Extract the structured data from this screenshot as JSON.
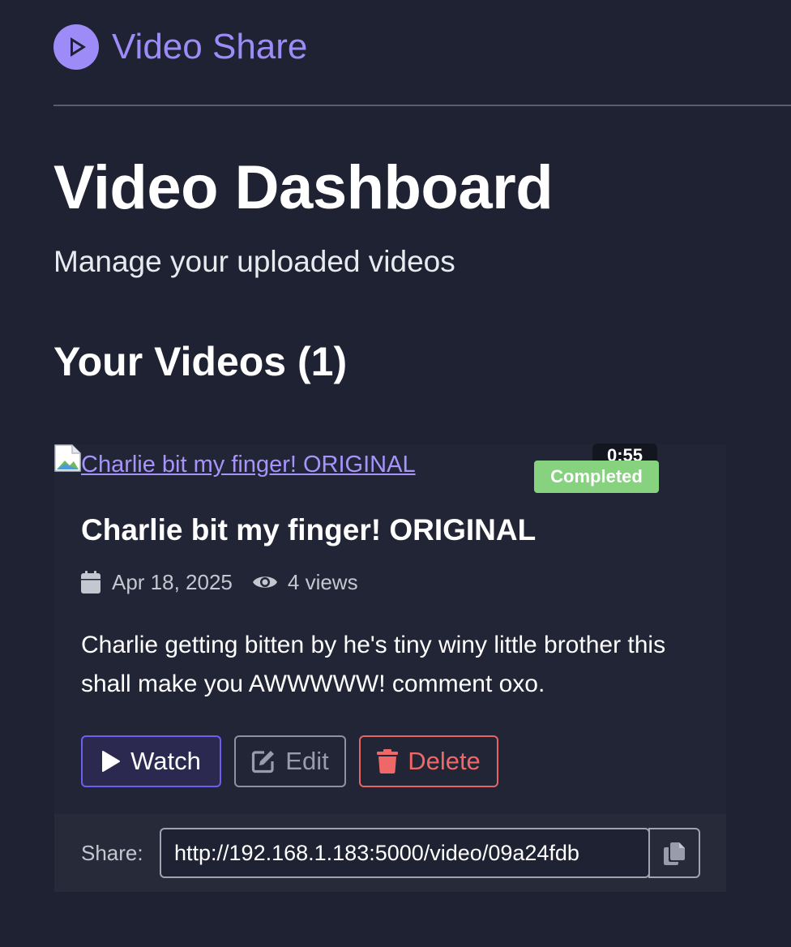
{
  "header": {
    "brand": "Video Share",
    "brand_icon": "play-circle-icon",
    "brand_color": "#9d8cf8"
  },
  "page": {
    "title": "Video Dashboard",
    "subtitle": "Manage your uploaded videos"
  },
  "videos_section": {
    "heading": "Your Videos (1)"
  },
  "video": {
    "thumbnail_alt": "Charlie bit my finger! ORIGINAL",
    "duration": "0:55",
    "status": "Completed",
    "title": "Charlie bit my finger! ORIGINAL",
    "date": "Apr 18, 2025",
    "views": "4 views",
    "description": "Charlie getting bitten by he's tiny winy little brother this shall make you AWWWWW! comment oxo.",
    "actions": {
      "watch": "Watch",
      "edit": "Edit",
      "delete": "Delete"
    },
    "share": {
      "label": "Share:",
      "url": "http://192.168.1.183:5000/video/09a24fdb"
    }
  },
  "colors": {
    "background": "#1f2232",
    "accent": "#6e5ef0",
    "success": "#86d27f",
    "danger": "#ef6767"
  }
}
